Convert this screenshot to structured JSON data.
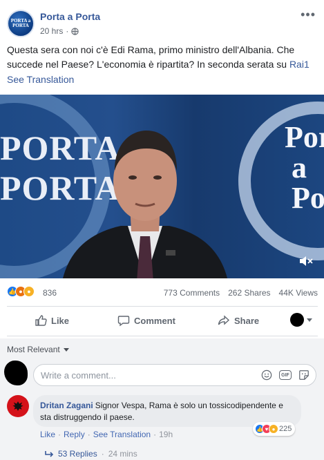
{
  "post": {
    "page_name": "Porta a Porta",
    "logo_text": "PORTA a PORTA",
    "time": "20 hrs",
    "dot": "·",
    "text": "Questa sera con noi c'è Edi Rama, primo ministro dell'Albania. Che succede nel Paese? L'economia è ripartita? In seconda serata su ",
    "text_link": "Rai1",
    "see_translation": "See Translation",
    "more": "•••"
  },
  "video": {
    "bg_text_left": "PORTA\nPORTA",
    "bg_text_right": "Porta\na Porta",
    "muted": true
  },
  "stats": {
    "reaction_count": "836",
    "comments": "773 Comments",
    "shares": "262 Shares",
    "views": "44K Views"
  },
  "actions": {
    "like": "Like",
    "comment": "Comment",
    "share": "Share"
  },
  "comments_section": {
    "sort": "Most Relevant",
    "placeholder": "Write a comment...",
    "gif_label": "GIF",
    "comment": {
      "author": "Dritan Zagani",
      "text": "Signor Vespa, Rama è solo un tossicodipendente e sta distruggendo il paese.",
      "reaction_count": "225",
      "like": "Like",
      "reply": "Reply",
      "see_translation": "See Translation",
      "time": "19h",
      "separator": "·"
    },
    "replies": {
      "label": "53 Replies",
      "time": "24 mins",
      "separator": "·"
    }
  },
  "colors": {
    "link": "#365899",
    "like_blue": "#1877f2",
    "angry_orange": "#e9710f",
    "haha_yellow": "#f7b125",
    "love_red": "#f33e58",
    "albanian_red": "#d4121a"
  }
}
